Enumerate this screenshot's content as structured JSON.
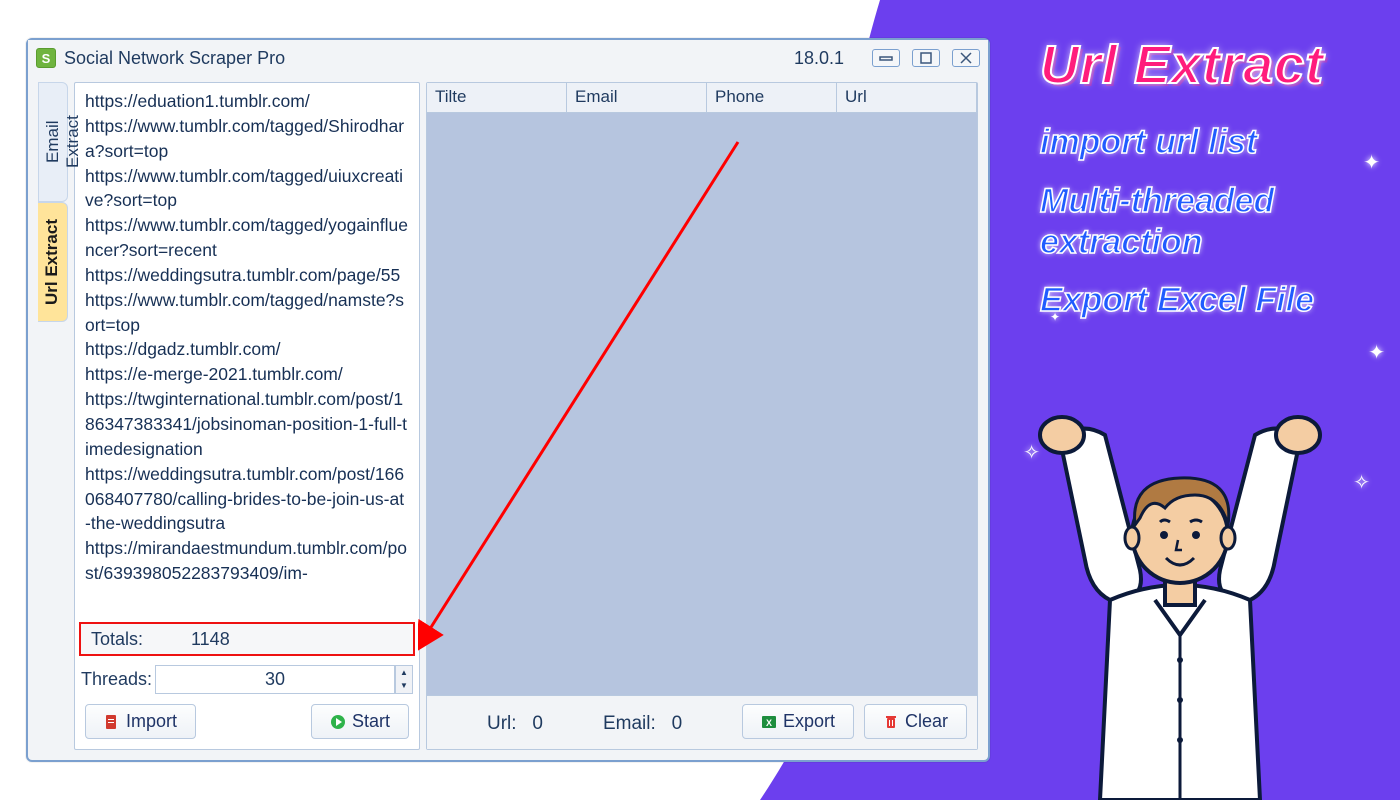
{
  "app": {
    "title": "Social Network Scraper Pro",
    "version": "18.0.1"
  },
  "tabs": {
    "email_extract": "Email Extract",
    "url_extract": "Url Extract"
  },
  "urls_text": "https://eduation1.tumblr.com/\nhttps://www.tumblr.com/tagged/Shirodhara?sort=top\nhttps://www.tumblr.com/tagged/uiuxcreative?sort=top\nhttps://www.tumblr.com/tagged/yogainfluencer?sort=recent\nhttps://weddingsutra.tumblr.com/page/55\nhttps://www.tumblr.com/tagged/namste?sort=top\nhttps://dgadz.tumblr.com/\nhttps://e-merge-2021.tumblr.com/\nhttps://twginternational.tumblr.com/post/186347383341/jobsinoman-position-1-full-timedesignation\nhttps://weddingsutra.tumblr.com/post/166068407780/calling-brides-to-be-join-us-at-the-weddingsutra\nhttps://mirandaestmundum.tumblr.com/post/639398052283793409/im-",
  "totals": {
    "label": "Totals:",
    "value": "1148"
  },
  "threads": {
    "label": "Threads:",
    "value": "30"
  },
  "buttons": {
    "import": "Import",
    "start": "Start",
    "export": "Export",
    "clear": "Clear"
  },
  "grid": {
    "columns": [
      "Tilte",
      "Email",
      "Phone",
      "Url"
    ]
  },
  "status": {
    "url_label": "Url:",
    "url_value": "0",
    "email_label": "Email:",
    "email_value": "0"
  },
  "hero": {
    "title": "Url Extract",
    "features": [
      "import url list",
      "Multi-threaded extraction",
      "Export Excel File"
    ]
  }
}
